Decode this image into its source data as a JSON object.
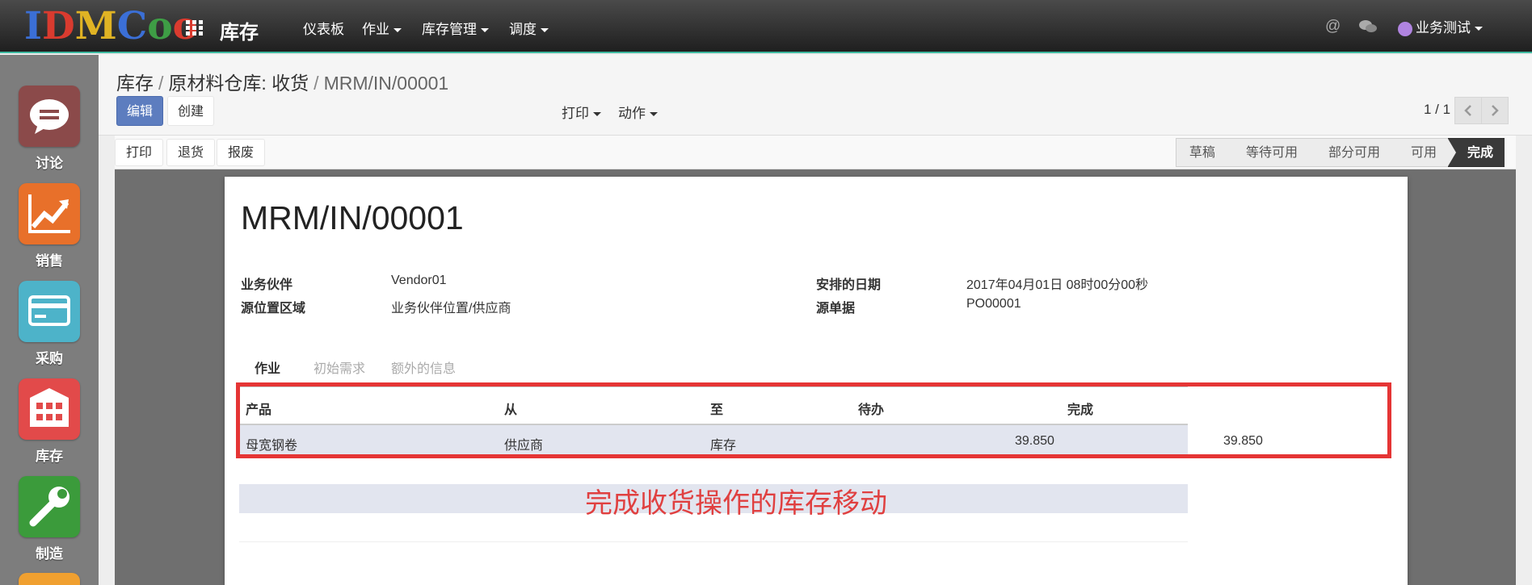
{
  "brand": {
    "logo_letters": [
      "I",
      "D",
      "M",
      "C",
      "o",
      "o"
    ],
    "logo_colors": [
      "#3b6fd6",
      "#d93b2f",
      "#e0b324",
      "#3b6fd6",
      "#3e9e45",
      "#d93b2f"
    ]
  },
  "topbar": {
    "app_title": "库存",
    "menu": [
      "仪表板",
      "作业",
      "库存管理",
      "调度"
    ],
    "menu_has_caret": [
      false,
      true,
      true,
      true
    ],
    "icons": [
      "at-icon",
      "chat-icon"
    ],
    "user": "业务测试"
  },
  "apps": [
    {
      "label": "讨论",
      "icon": "chat-bubble-icon",
      "color": "#8b4a4a"
    },
    {
      "label": "销售",
      "icon": "trend-chart-icon",
      "color": "#e8702a"
    },
    {
      "label": "采购",
      "icon": "credit-card-icon",
      "color": "#4db3c9"
    },
    {
      "label": "库存",
      "icon": "warehouse-icon",
      "color": "#e24a4a"
    },
    {
      "label": "制造",
      "icon": "wrench-icon",
      "color": "#3b9b3b"
    }
  ],
  "breadcrumb": {
    "items": [
      "库存",
      "原材料仓库: 收货"
    ],
    "current": "MRM/IN/00001"
  },
  "actions": {
    "edit": "编辑",
    "create": "创建",
    "print": "打印",
    "action": "动作"
  },
  "pager": {
    "text": "1 / 1"
  },
  "statusbar": {
    "buttons": [
      "打印",
      "退货",
      "报废"
    ],
    "stages": [
      "草稿",
      "等待可用",
      "部分可用",
      "可用",
      "完成"
    ],
    "active_stage": "完成"
  },
  "record": {
    "title": "MRM/IN/00001",
    "fields_left": [
      {
        "label": "业务伙伴",
        "value": "Vendor01"
      },
      {
        "label": "源位置区域",
        "value": "业务伙伴位置/供应商"
      }
    ],
    "fields_right": [
      {
        "label": "安排的日期",
        "value": "2017年04月01日 08时00分00秒"
      },
      {
        "label": "源单据",
        "value": "PO00001"
      }
    ]
  },
  "tabs": [
    "作业",
    "初始需求",
    "额外的信息"
  ],
  "table": {
    "headers": [
      "产品",
      "从",
      "至",
      "待办",
      "完成"
    ],
    "rows": [
      [
        "母宽钢卷",
        "供应商",
        "库存",
        "39.850",
        "39.850"
      ]
    ]
  },
  "annotation": "完成收货操作的库存移动"
}
